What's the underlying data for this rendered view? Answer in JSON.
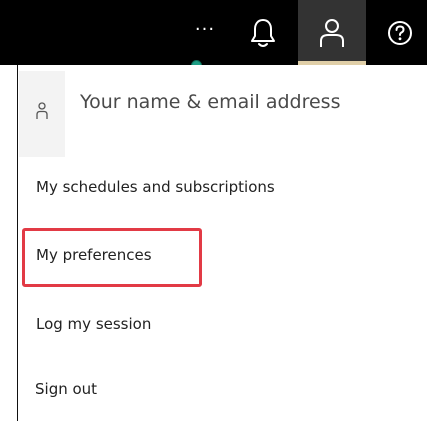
{
  "topbar": {
    "more_label": "···",
    "icons": {
      "bell": "bell-icon",
      "user": "user-icon",
      "help": "help-circle-icon"
    },
    "accent_color": "#e0cfa8",
    "notification_color": "#1e9e85"
  },
  "menu": {
    "profile_text": "Your name & email address",
    "items": [
      {
        "label": "My schedules and subscriptions"
      },
      {
        "label": "My preferences"
      },
      {
        "label": "Log my session"
      },
      {
        "label": "Sign out"
      }
    ],
    "highlight_color": "#e23a45"
  }
}
